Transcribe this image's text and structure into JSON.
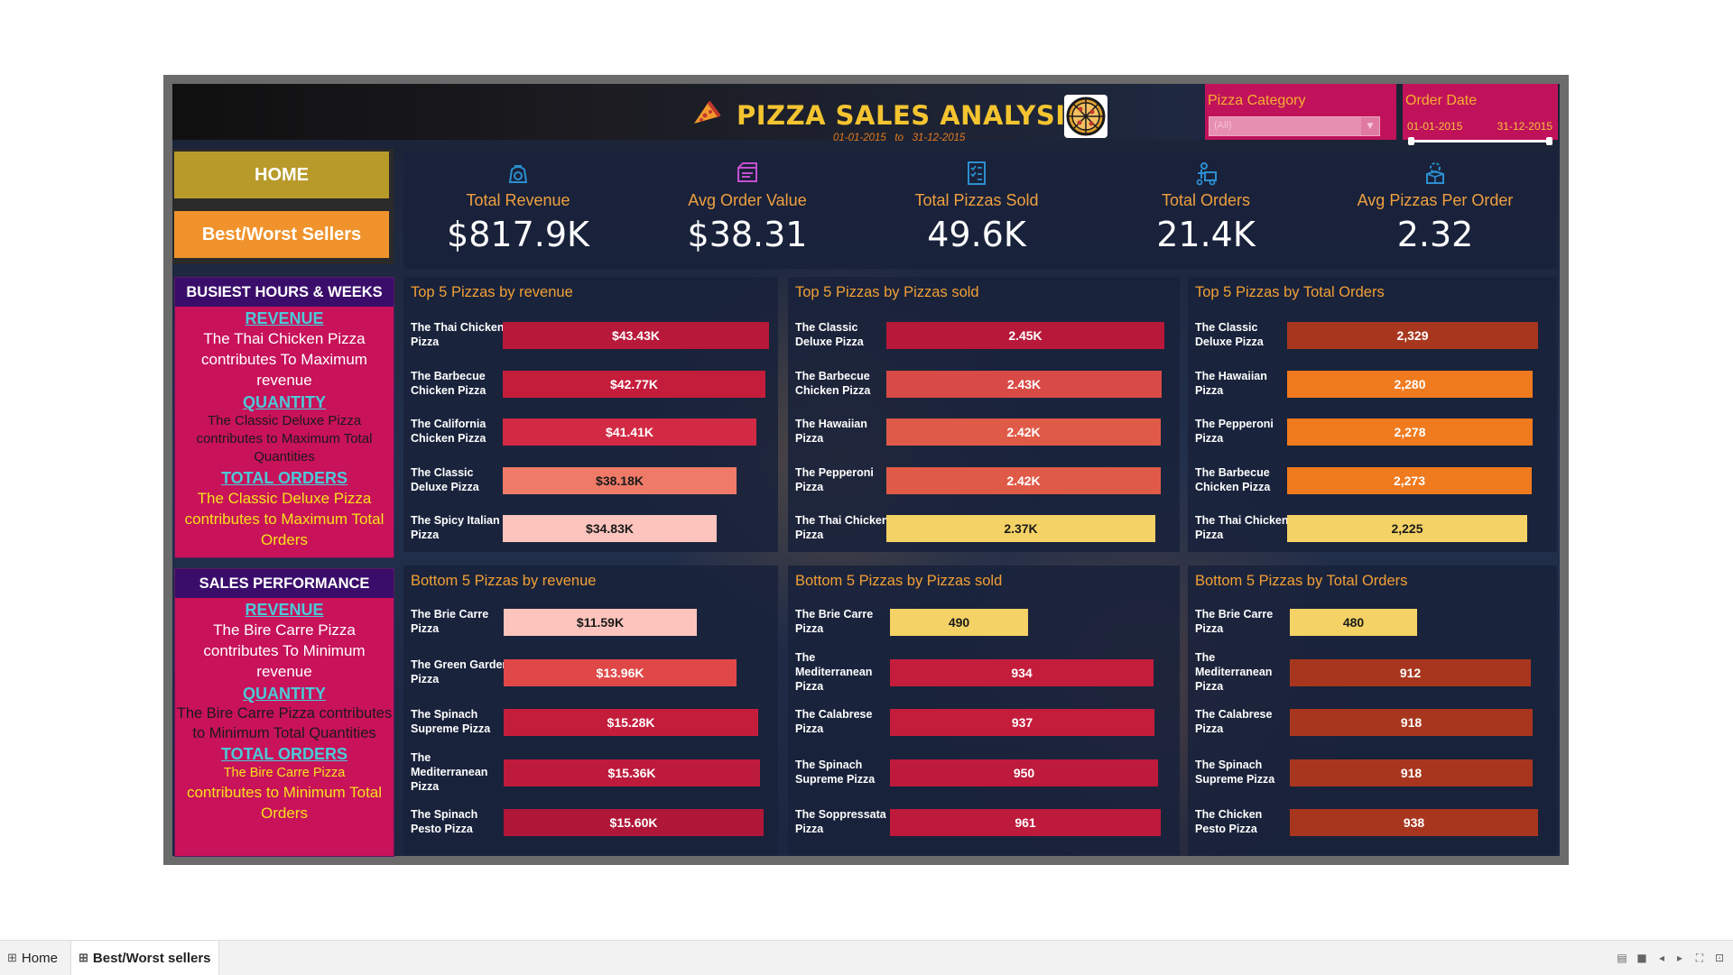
{
  "header": {
    "title": "PIZZA SALES ANALYSIS",
    "date_from": "01-01-2015",
    "date_to_word": "to",
    "date_to": "31-12-2015"
  },
  "filters": {
    "category_label": "Pizza Category",
    "category_value": "(All)",
    "date_label": "Order Date",
    "date_start": "01-01-2015",
    "date_end": "31-12-2015"
  },
  "nav": {
    "home": "HOME",
    "best_worst": "Best/Worst Sellers"
  },
  "busiest": {
    "heading": "BUSIEST HOURS & WEEKS",
    "revenue_h": "REVENUE",
    "revenue_t": "The Thai Chicken Pizza contributes To Maximum revenue",
    "quantity_h": "QUANTITY",
    "quantity_t": "The Classic Deluxe Pizza contributes to Maximum Total Quantities",
    "orders_h": "TOTAL ORDERS",
    "orders_t": "The Classic Deluxe Pizza contributes to Maximum Total Orders"
  },
  "sales_perf": {
    "heading": "SALES PERFORMANCE",
    "revenue_h": "REVENUE",
    "revenue_t": "The Bire Carre Pizza contributes To Minimum revenue",
    "quantity_h": "QUANTITY",
    "quantity_t": "The Bire Carre Pizza contributes to Minimum Total Quantities",
    "orders_h": "TOTAL ORDERS",
    "orders_t1": "The Bire Carre Pizza",
    "orders_t2": "contributes to Minimum Total Orders"
  },
  "kpis": [
    {
      "label": "Total Revenue",
      "value": "$817.9K",
      "icon": "money-bag-icon"
    },
    {
      "label": "Avg Order Value",
      "value": "$38.31",
      "icon": "box-icon"
    },
    {
      "label": "Total Pizzas Sold",
      "value": "49.6K",
      "icon": "checklist-icon"
    },
    {
      "label": "Total Orders",
      "value": "21.4K",
      "icon": "delivery-icon"
    },
    {
      "label": "Avg Pizzas Per Order",
      "value": "2.32",
      "icon": "gear-box-icon"
    }
  ],
  "chart_data": [
    {
      "type": "bar",
      "orientation": "horizontal",
      "title": "Top 5 Pizzas by revenue",
      "categories": [
        "The Thai Chicken Pizza",
        "The Barbecue Chicken Pizza",
        "The California Chicken Pizza",
        "The Classic Deluxe Pizza",
        "The Spicy Italian Pizza"
      ],
      "values": [
        43430,
        42770,
        41410,
        38180,
        34830
      ],
      "labels": [
        "$43.43K",
        "$42.77K",
        "$41.41K",
        "$38.18K",
        "$34.83K"
      ],
      "colors": [
        "#b8183a",
        "#c41d3c",
        "#d22a44",
        "#f07a68",
        "#fcc4bc"
      ],
      "label_colors": [
        "#ffffff",
        "#ffffff",
        "#ffffff",
        "#1a1a1a",
        "#1a1a1a"
      ]
    },
    {
      "type": "bar",
      "orientation": "horizontal",
      "title": "Top 5 Pizzas by Pizzas sold",
      "categories": [
        "The Classic Deluxe Pizza",
        "The Barbecue Chicken Pizza",
        "The Hawaiian Pizza",
        "The Pepperoni Pizza",
        "The Thai Chicken Pizza"
      ],
      "values": [
        2450,
        2430,
        2420,
        2420,
        2370
      ],
      "labels": [
        "2.45K",
        "2.43K",
        "2.42K",
        "2.42K",
        "2.37K"
      ],
      "colors": [
        "#b8183a",
        "#d84a46",
        "#e05a48",
        "#e05a48",
        "#f5d265"
      ],
      "label_colors": [
        "#ffffff",
        "#ffffff",
        "#ffffff",
        "#ffffff",
        "#1a1a1a"
      ]
    },
    {
      "type": "bar",
      "orientation": "horizontal",
      "title": "Top 5 Pizzas by Total Orders",
      "categories": [
        "The Classic Deluxe Pizza",
        "The Hawaiian Pizza",
        "The Pepperoni Pizza",
        "The Barbecue Chicken Pizza",
        "The Thai Chicken Pizza"
      ],
      "values": [
        2329,
        2280,
        2278,
        2273,
        2225
      ],
      "labels": [
        "2,329",
        "2,280",
        "2,278",
        "2,273",
        "2,225"
      ],
      "colors": [
        "#a8361e",
        "#f07a1e",
        "#f07a1e",
        "#f07a1e",
        "#f5d265"
      ],
      "label_colors": [
        "#ffffff",
        "#ffffff",
        "#ffffff",
        "#ffffff",
        "#1a1a1a"
      ]
    },
    {
      "type": "bar",
      "orientation": "horizontal",
      "title": "Bottom 5 Pizzas by revenue",
      "categories": [
        "The Brie Carre Pizza",
        "The Green Garden Pizza",
        "The Spinach Supreme Pizza",
        "The Mediterranean Pizza",
        "The Spinach Pesto Pizza"
      ],
      "values": [
        11590,
        13960,
        15280,
        15360,
        15600
      ],
      "labels": [
        "$11.59K",
        "$13.96K",
        "$15.28K",
        "$15.36K",
        "$15.60K"
      ],
      "colors": [
        "#fcc4bc",
        "#e04848",
        "#c41d3c",
        "#be1a3c",
        "#b01638"
      ],
      "label_colors": [
        "#1a1a1a",
        "#ffffff",
        "#ffffff",
        "#ffffff",
        "#ffffff"
      ]
    },
    {
      "type": "bar",
      "orientation": "horizontal",
      "title": "Bottom 5 Pizzas by Pizzas sold",
      "categories": [
        "The Brie Carre Pizza",
        "The Mediterranean Pizza",
        "The Calabrese Pizza",
        "The Spinach Supreme Pizza",
        "The Soppressata Pizza"
      ],
      "values": [
        490,
        934,
        937,
        950,
        961
      ],
      "labels": [
        "490",
        "934",
        "937",
        "950",
        "961"
      ],
      "colors": [
        "#f5d265",
        "#c41d3c",
        "#c41d3c",
        "#be1a3c",
        "#be1a3c"
      ],
      "label_colors": [
        "#1a1a1a",
        "#ffffff",
        "#ffffff",
        "#ffffff",
        "#ffffff"
      ]
    },
    {
      "type": "bar",
      "orientation": "horizontal",
      "title": "Bottom 5 Pizzas by Total Orders",
      "categories": [
        "The Brie Carre Pizza",
        "The Mediterranean Pizza",
        "The Calabrese Pizza",
        "The Spinach Supreme Pizza",
        "The Chicken Pesto Pizza"
      ],
      "values": [
        480,
        912,
        918,
        918,
        938
      ],
      "labels": [
        "480",
        "912",
        "918",
        "918",
        "938"
      ],
      "colors": [
        "#f5d265",
        "#a8361e",
        "#a8361e",
        "#a8361e",
        "#a8361e"
      ],
      "label_colors": [
        "#1a1a1a",
        "#ffffff",
        "#ffffff",
        "#ffffff",
        "#ffffff"
      ]
    }
  ],
  "tabs": [
    {
      "label": "Home",
      "icon": "grid-icon"
    },
    {
      "label": "Best/Worst sellers",
      "icon": "grid-icon"
    }
  ]
}
